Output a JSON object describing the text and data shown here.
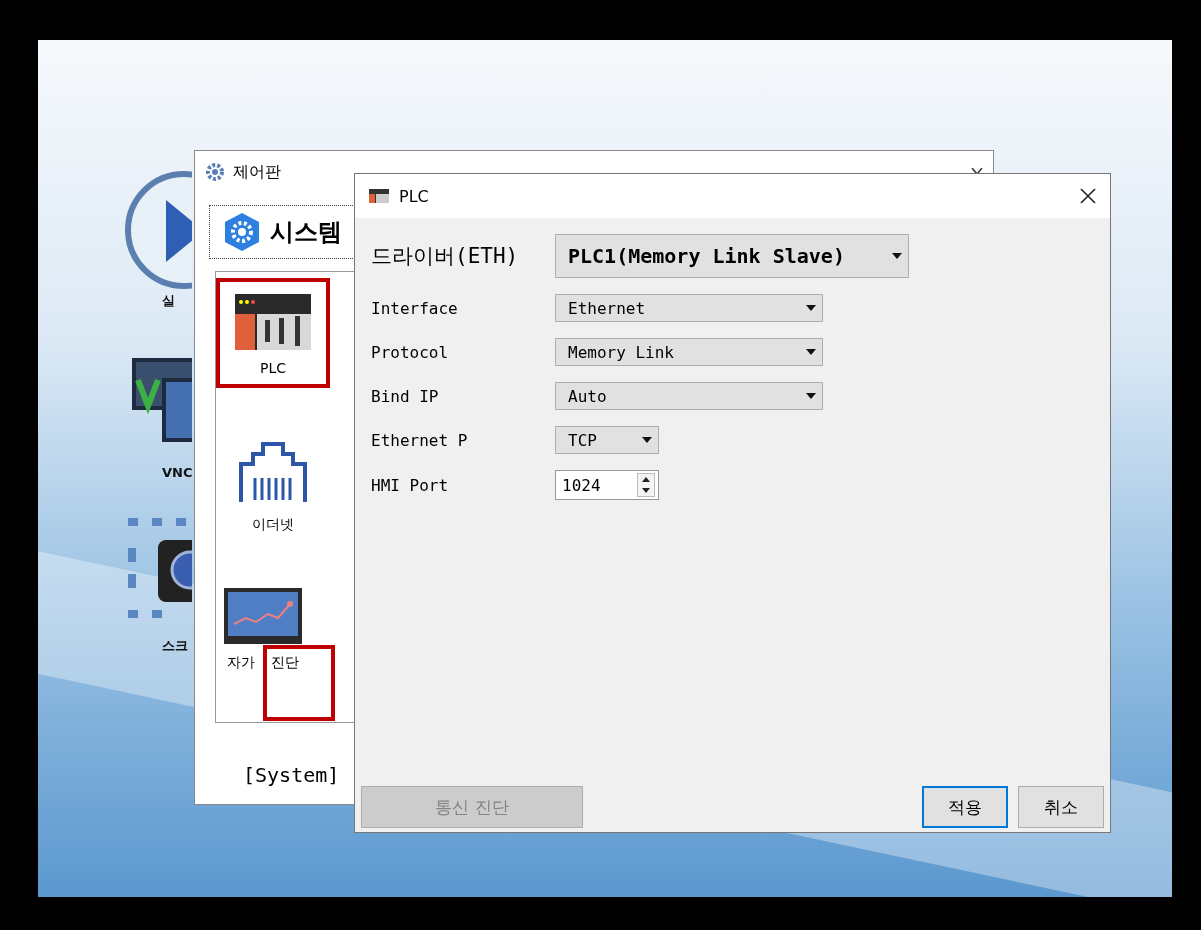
{
  "desktop_icons": [
    {
      "kind": "play",
      "label": "실"
    },
    {
      "kind": "vnc",
      "label": "VNC"
    },
    {
      "kind": "camera",
      "label": "스크"
    }
  ],
  "control_panel": {
    "title": "제어판",
    "tab": "시스템",
    "items": [
      {
        "kind": "plc",
        "label": "PLC",
        "selected": true
      },
      {
        "kind": "ethernet",
        "label": "이더넷",
        "selected": false
      },
      {
        "kind": "diagnosis",
        "label": "자가 진단",
        "selected": false
      }
    ],
    "footer": "[System]"
  },
  "dialog": {
    "title": "PLC",
    "driver_label": "드라이버(ETH)",
    "driver_value": "PLC1(Memory Link Slave)",
    "fields": [
      {
        "kind": "dropdown",
        "label": "Interface",
        "value": "Ethernet"
      },
      {
        "kind": "dropdown",
        "label": "Protocol",
        "value": "Memory Link"
      },
      {
        "kind": "dropdown",
        "label": "Bind IP",
        "value": "Auto"
      },
      {
        "kind": "short-dropdown",
        "label": "Ethernet P",
        "value": "TCP"
      },
      {
        "kind": "spinner",
        "label": "HMI Port",
        "value": "1024"
      }
    ],
    "buttons": [
      {
        "label": "통신 진단",
        "disabled": true,
        "default": false
      },
      {
        "label": "적용",
        "disabled": false,
        "default": true
      },
      {
        "label": "취소",
        "disabled": false,
        "default": false
      }
    ]
  }
}
